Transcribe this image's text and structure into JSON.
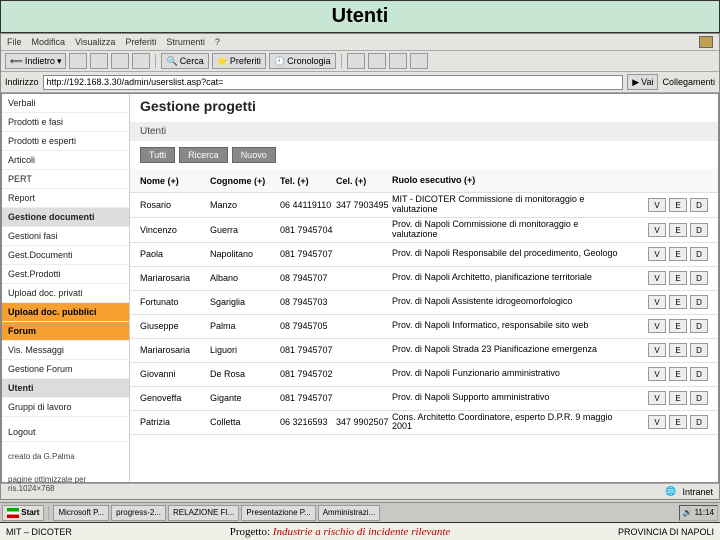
{
  "slide": {
    "title": "Utenti"
  },
  "menus": [
    "File",
    "Modifica",
    "Visualizza",
    "Preferiti",
    "Strumenti",
    "?"
  ],
  "toolbar": {
    "back": "Indietro",
    "search": "Cerca",
    "favorites": "Preferiti",
    "history": "Cronologia"
  },
  "address": {
    "label": "Indirizzo",
    "url": "http://192.168.3.30/admin/userslist.asp?cat=",
    "go": "Vai",
    "links": "Collegamenti"
  },
  "sidebar": {
    "items": [
      {
        "label": "Verbali",
        "hl": false
      },
      {
        "label": "Prodotti e fasi",
        "hl": false
      },
      {
        "label": "Prodotti e esperti",
        "hl": false
      },
      {
        "label": "Articoli",
        "hl": false
      },
      {
        "label": "PERT",
        "hl": false
      },
      {
        "label": "Report",
        "hl": false
      },
      {
        "label": "Gestione documenti",
        "hl": false,
        "sel": true
      },
      {
        "label": "Gestioni fasi",
        "hl": false
      },
      {
        "label": "Gest.Documenti",
        "hl": false
      },
      {
        "label": "Gest.Prodotti",
        "hl": false
      },
      {
        "label": "Upload doc. privati",
        "hl": false
      },
      {
        "label": "Upload doc. pubblici",
        "hl": true
      },
      {
        "label": "Forum",
        "hl": true
      },
      {
        "label": "Vis. Messaggi",
        "hl": false
      },
      {
        "label": "Gestione Forum",
        "hl": false
      },
      {
        "label": "Utenti",
        "hl": false,
        "sel": true
      },
      {
        "label": "Gruppi di lavoro",
        "hl": false
      }
    ],
    "logout": "Logout",
    "footer1": "creato da G.Palma",
    "footer2": "pagine ottimizzate per ris.1024×768"
  },
  "page": {
    "title": "Gestione progetti",
    "crumb": "Utenti"
  },
  "tabs": [
    "Tutti",
    "Ricerca",
    "Nuovo"
  ],
  "columns": {
    "nome": "Nome (+)",
    "cognome": "Cognome (+)",
    "tel": "Tel. (+)",
    "cel": "Cel. (+)",
    "ruolo": "Ruolo esecutivo (+)"
  },
  "rows": [
    {
      "nome": "Rosario",
      "cognome": "Manzo",
      "tel": "06 44119110",
      "cel": "347 7903495",
      "ruolo": "MIT - DICOTER Commissione di monitoraggio e valutazione",
      "b": [
        "V",
        "E",
        "D"
      ]
    },
    {
      "nome": "Vincenzo",
      "cognome": "Guerra",
      "tel": "081 7945704",
      "cel": "",
      "ruolo": "Prov. di Napoli Commissione di monitoraggio e valutazione",
      "b": [
        "V",
        "E",
        "D"
      ]
    },
    {
      "nome": "Paola",
      "cognome": "Napolitano",
      "tel": "081 7945707",
      "cel": "",
      "ruolo": "Prov. di Napoli Responsabile del procedimento, Geologo",
      "b": [
        "V",
        "E",
        "D"
      ]
    },
    {
      "nome": "Mariarosaria",
      "cognome": "Albano",
      "tel": "08 7945707",
      "cel": "",
      "ruolo": "Prov. di Napoli Architetto, pianificazione territoriale",
      "b": [
        "V",
        "E",
        "D"
      ]
    },
    {
      "nome": "Fortunato",
      "cognome": "Sgariglia",
      "tel": "08 7945703",
      "cel": "",
      "ruolo": "Prov. di Napoli Assistente idrogeomorfologico",
      "b": [
        "V",
        "E",
        "D"
      ]
    },
    {
      "nome": "Giuseppe",
      "cognome": "Palma",
      "tel": "08 7945705",
      "cel": "",
      "ruolo": "Prov. di Napoli Informatico, responsabile sito web",
      "b": [
        "V",
        "E",
        "D"
      ]
    },
    {
      "nome": "Mariarosaria",
      "cognome": "Liguori",
      "tel": "081 7945707",
      "cel": "",
      "ruolo": "Prov. di Napoli Strada 23 Pianificazione emergenza",
      "b": [
        "V",
        "E",
        "D"
      ]
    },
    {
      "nome": "Giovanni",
      "cognome": "De Rosa",
      "tel": "081 7945702",
      "cel": "",
      "ruolo": "Prov. di Napoli Funzionario amministrativo",
      "b": [
        "V",
        "E",
        "D"
      ]
    },
    {
      "nome": "Genoveffa",
      "cognome": "Gigante",
      "tel": "081 7945707",
      "cel": "",
      "ruolo": "Prov. di Napoli Supporto amministrativo",
      "b": [
        "V",
        "E",
        "D"
      ]
    },
    {
      "nome": "Patrizia",
      "cognome": "Colletta",
      "tel": "06 3216593",
      "cel": "347 9902507",
      "ruolo": "Cons. Architetto Coordinatore, esperto D.P.R. 9 maggio 2001",
      "b": [
        "V",
        "E",
        "D"
      ]
    }
  ],
  "statusbar": {
    "done": "",
    "zone": "Intranet"
  },
  "taskbar": {
    "start": "Start",
    "items": [
      "Microsoft P...",
      "progress-2...",
      "RELAZIONE FI...",
      "Presentazione P...",
      "Amministrazi..."
    ],
    "time": "11:14"
  },
  "footer": {
    "left": "MIT – DICOTER",
    "center_label": "Progetto:",
    "center_text": "Industrie a rischio di incidente rilevante",
    "right": "PROVINCIA DI NAPOLI"
  }
}
